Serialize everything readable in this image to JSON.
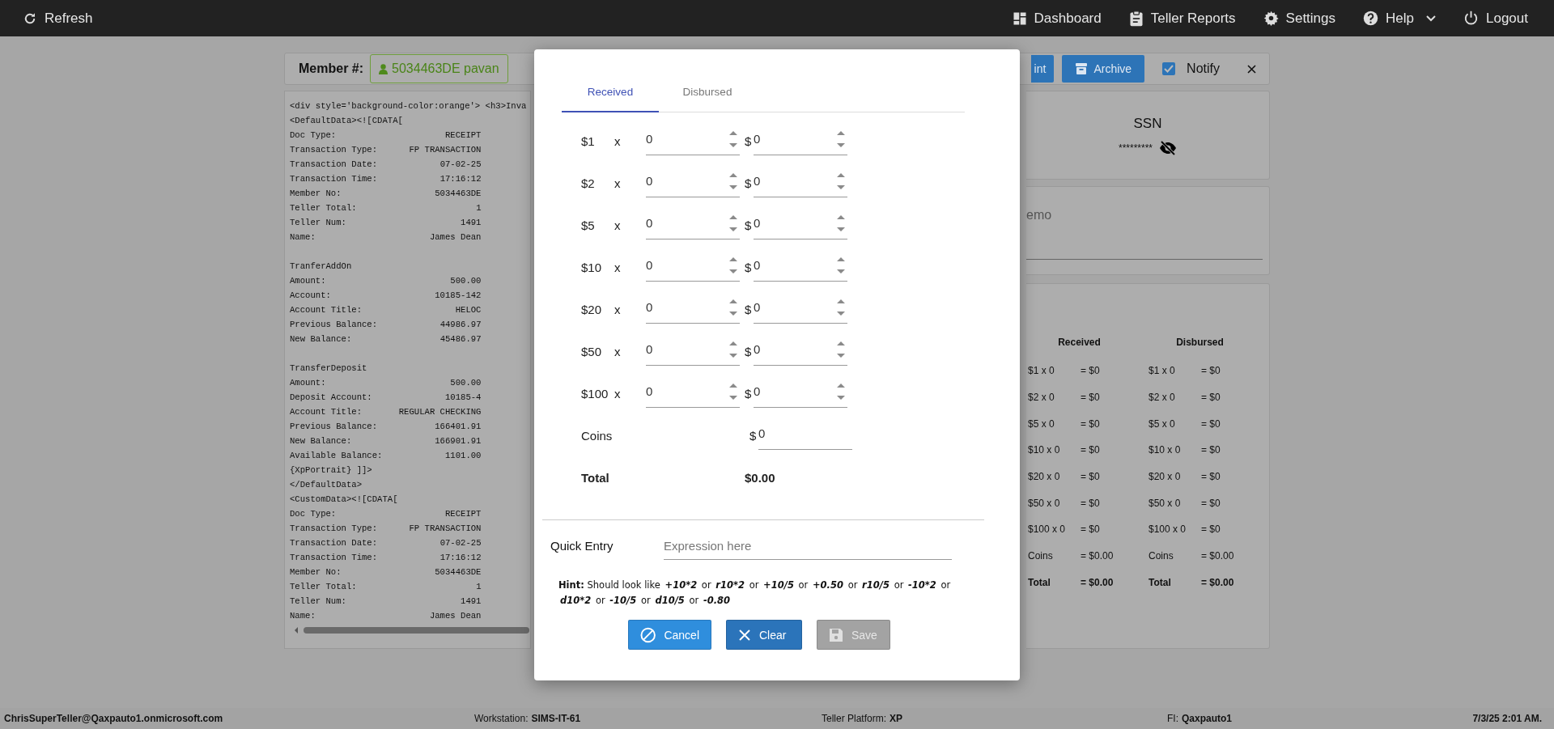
{
  "topbar": {
    "refresh": "Refresh",
    "nav": [
      {
        "label": "Dashboard",
        "dropdown": false
      },
      {
        "label": "Teller Reports",
        "dropdown": false
      },
      {
        "label": "Settings",
        "dropdown": false
      },
      {
        "label": "Help",
        "dropdown": true
      },
      {
        "label": "Logout",
        "dropdown": false
      }
    ]
  },
  "member_bar": {
    "label": "Member #:",
    "member": "5034463DE pavan",
    "buttons": [
      {
        "label": "int"
      },
      {
        "label": "Archive"
      }
    ],
    "notify": {
      "label": "Notify",
      "checked": true
    }
  },
  "receipt": {
    "lines": [
      {
        "kind": "text",
        "text": "<div style='background-color:orange'> <h3>Inva"
      },
      {
        "kind": "text",
        "text": "<DefaultData><![CDATA["
      },
      {
        "kind": "pair",
        "label": "Doc Type:",
        "value": "RECEIPT"
      },
      {
        "kind": "pair",
        "label": "Transaction Type:",
        "value": "FP TRANSACTION"
      },
      {
        "kind": "pair",
        "label": "Transaction Date:",
        "value": "07-02-25"
      },
      {
        "kind": "pair",
        "label": "Transaction Time:",
        "value": "17:16:12"
      },
      {
        "kind": "pair",
        "label": "Member No:",
        "value": "5034463DE"
      },
      {
        "kind": "pair",
        "label": "Teller Total:",
        "value": "1"
      },
      {
        "kind": "pair",
        "label": "Teller Num:",
        "value": "1491"
      },
      {
        "kind": "pair",
        "label": "Name:",
        "value": "James Dean"
      },
      {
        "kind": "gap"
      },
      {
        "kind": "text",
        "text": "TranferAddOn"
      },
      {
        "kind": "pair",
        "label": "Amount:",
        "value": "500.00"
      },
      {
        "kind": "pair",
        "label": "Account:",
        "value": "10185-142"
      },
      {
        "kind": "pair",
        "label": "Account Title:",
        "value": "HELOC"
      },
      {
        "kind": "pair",
        "label": "Previous Balance:",
        "value": "44986.97"
      },
      {
        "kind": "pair",
        "label": "New Balance:",
        "value": "45486.97"
      },
      {
        "kind": "gap"
      },
      {
        "kind": "text",
        "text": "TransferDeposit"
      },
      {
        "kind": "pair",
        "label": "Amount:",
        "value": "500.00"
      },
      {
        "kind": "pair",
        "label": "Deposit Account:",
        "value": "10185-4"
      },
      {
        "kind": "pair",
        "label": "Account Title:",
        "value": "REGULAR CHECKING"
      },
      {
        "kind": "pair",
        "label": "Previous Balance:",
        "value": "166401.91"
      },
      {
        "kind": "pair",
        "label": "New Balance:",
        "value": "166901.91"
      },
      {
        "kind": "pair",
        "label": "Available Balance:",
        "value": "1101.00"
      },
      {
        "kind": "text",
        "text": "{XpPortrait} ]]>"
      },
      {
        "kind": "text",
        "text": "</DefaultData>"
      },
      {
        "kind": "text",
        "text": "<CustomData><![CDATA["
      },
      {
        "kind": "pair",
        "label": "Doc Type:",
        "value": "RECEIPT"
      },
      {
        "kind": "pair",
        "label": "Transaction Type:",
        "value": "FP TRANSACTION"
      },
      {
        "kind": "pair",
        "label": "Transaction Date:",
        "value": "07-02-25"
      },
      {
        "kind": "pair",
        "label": "Transaction Time:",
        "value": "17:16:12"
      },
      {
        "kind": "pair",
        "label": "Member No:",
        "value": "5034463DE"
      },
      {
        "kind": "pair",
        "label": "Teller Total:",
        "value": "1"
      },
      {
        "kind": "pair",
        "label": "Teller Num:",
        "value": "1491"
      },
      {
        "kind": "pair",
        "label": "Name:",
        "value": "James Dean"
      }
    ]
  },
  "ssn": {
    "title": "SSN",
    "value": "*********"
  },
  "memo": {
    "label": "emo"
  },
  "summary": {
    "columns": [
      {
        "title": "Received",
        "rows": [
          {
            "kind": "line",
            "label": "$1 x 0",
            "result": "= $0"
          },
          {
            "kind": "line",
            "label": "$2 x 0",
            "result": "= $0"
          },
          {
            "kind": "line",
            "label": "$5 x 0",
            "result": "= $0"
          },
          {
            "kind": "line",
            "label": "$10 x 0",
            "result": "= $0"
          },
          {
            "kind": "line",
            "label": "$20 x 0",
            "result": "= $0"
          },
          {
            "kind": "line",
            "label": "$50 x 0",
            "result": "= $0"
          },
          {
            "kind": "line",
            "label": "$100 x 0",
            "result": "= $0"
          },
          {
            "kind": "line",
            "label": "Coins",
            "result": "= $0.00"
          },
          {
            "kind": "total",
            "label": "Total",
            "result": "= $0.00"
          }
        ]
      },
      {
        "title": "Disbursed",
        "rows": [
          {
            "kind": "line",
            "label": "$1 x 0",
            "result": "= $0"
          },
          {
            "kind": "line",
            "label": "$2 x 0",
            "result": "= $0"
          },
          {
            "kind": "line",
            "label": "$5 x 0",
            "result": "= $0"
          },
          {
            "kind": "line",
            "label": "$10 x 0",
            "result": "= $0"
          },
          {
            "kind": "line",
            "label": "$20 x 0",
            "result": "= $0"
          },
          {
            "kind": "line",
            "label": "$50 x 0",
            "result": "= $0"
          },
          {
            "kind": "line",
            "label": "$100 x 0",
            "result": "= $0"
          },
          {
            "kind": "line",
            "label": "Coins",
            "result": "= $0.00"
          },
          {
            "kind": "total",
            "label": "Total",
            "result": "= $0.00"
          }
        ]
      }
    ]
  },
  "dialog": {
    "tabs": [
      {
        "label": "Received",
        "selected": true
      },
      {
        "label": "Disbursed",
        "selected": false
      }
    ],
    "rows": [
      {
        "denomination": "$1",
        "multiplier": "x",
        "count": "0",
        "currency": "$",
        "amount": "0"
      },
      {
        "denomination": "$2",
        "multiplier": "x",
        "count": "0",
        "currency": "$",
        "amount": "0"
      },
      {
        "denomination": "$5",
        "multiplier": "x",
        "count": "0",
        "currency": "$",
        "amount": "0"
      },
      {
        "denomination": "$10",
        "multiplier": "x",
        "count": "0",
        "currency": "$",
        "amount": "0"
      },
      {
        "denomination": "$20",
        "multiplier": "x",
        "count": "0",
        "currency": "$",
        "amount": "0"
      },
      {
        "denomination": "$50",
        "multiplier": "x",
        "count": "0",
        "currency": "$",
        "amount": "0"
      },
      {
        "denomination": "$100",
        "multiplier": "x",
        "count": "0",
        "currency": "$",
        "amount": "0"
      }
    ],
    "coins": {
      "label": "Coins",
      "currency": "$",
      "amount": "0"
    },
    "total": {
      "label": "Total",
      "value": "$0.00"
    },
    "quick_entry": {
      "label": "Quick Entry",
      "placeholder": "Expression here"
    },
    "hint": [
      {
        "kind": "label",
        "text": "Hint:"
      },
      {
        "kind": "word",
        "text": "Should look like"
      },
      {
        "kind": "code",
        "text": "+10*2"
      },
      {
        "kind": "word",
        "text": "or"
      },
      {
        "kind": "code",
        "text": "r10*2"
      },
      {
        "kind": "word",
        "text": "or"
      },
      {
        "kind": "code",
        "text": "+10/5"
      },
      {
        "kind": "word",
        "text": "or"
      },
      {
        "kind": "code",
        "text": "+0.50"
      },
      {
        "kind": "word",
        "text": "or"
      },
      {
        "kind": "code",
        "text": "r10/5"
      },
      {
        "kind": "word",
        "text": "or"
      },
      {
        "kind": "code",
        "text": "-10*2"
      },
      {
        "kind": "word",
        "text": "or"
      },
      {
        "kind": "code",
        "text": "d10*2"
      },
      {
        "kind": "word",
        "text": "or"
      },
      {
        "kind": "code",
        "text": "-10/5"
      },
      {
        "kind": "word",
        "text": "or"
      },
      {
        "kind": "code",
        "text": "d10/5"
      },
      {
        "kind": "word",
        "text": "or"
      },
      {
        "kind": "code",
        "text": "-0.80"
      }
    ],
    "buttons": [
      {
        "label": "Cancel",
        "disabled": false
      },
      {
        "label": "Clear",
        "disabled": false
      },
      {
        "label": "Save",
        "disabled": true
      }
    ]
  },
  "status_bar": [
    {
      "value": "ChrisSuperTeller@Qaxpauto1.onmicrosoft.com"
    },
    {
      "label": "Workstation:",
      "value": "SIMS-IT-61"
    },
    {
      "label": "Teller Platform:",
      "value": "XP"
    },
    {
      "label": "FI:",
      "value": "Qaxpauto1"
    },
    {
      "value": "7/3/25 2:01 AM."
    }
  ]
}
